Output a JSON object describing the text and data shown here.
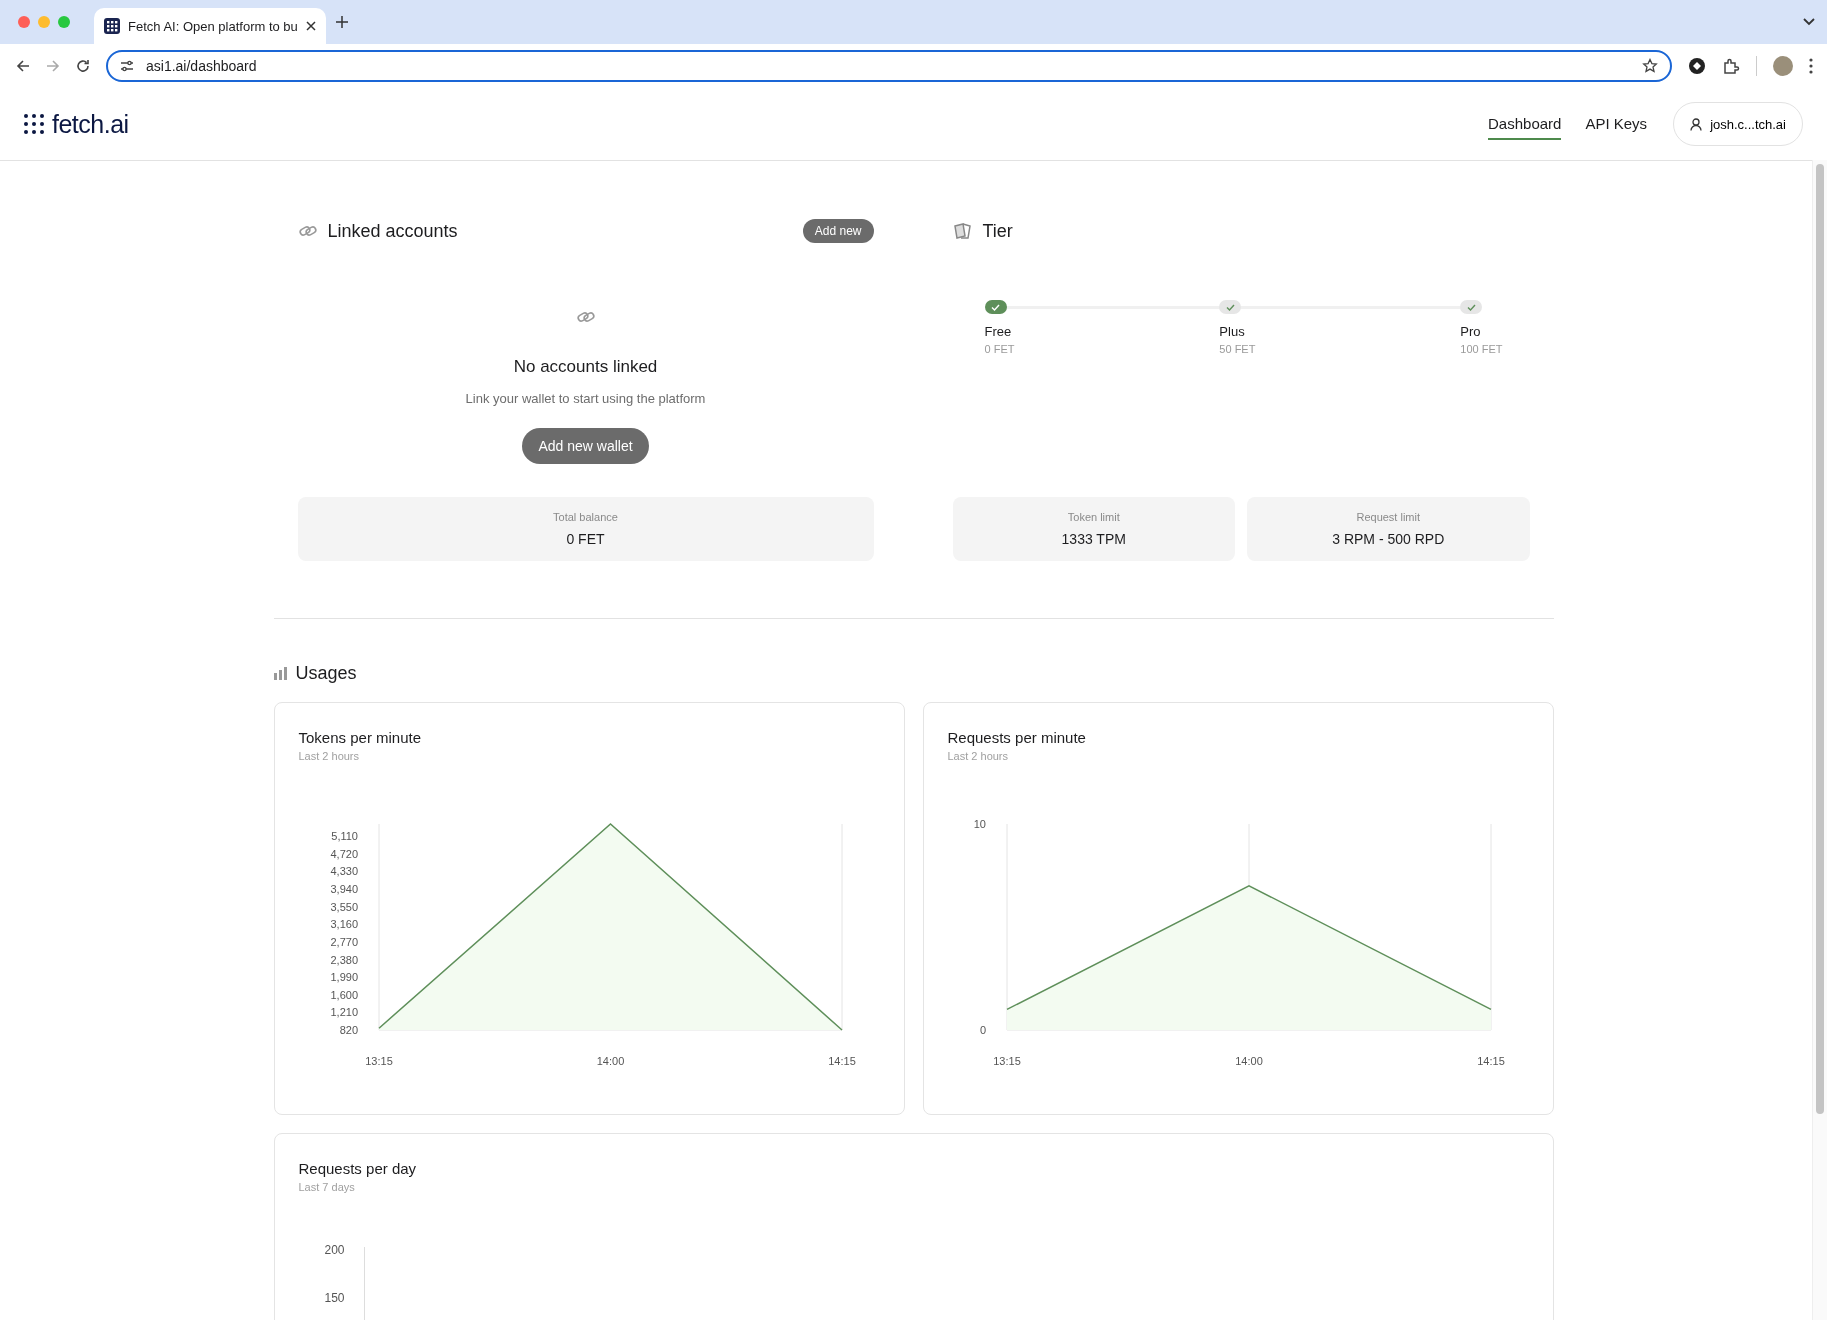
{
  "browser": {
    "tabs": [
      {
        "title": "Fetch AI: Open platform to bu",
        "selected": true
      }
    ],
    "url": "asi1.ai/dashboard"
  },
  "header": {
    "logo": "fetch.ai",
    "nav": [
      {
        "label": "Dashboard",
        "selected": true
      },
      {
        "label": "API Keys",
        "selected": false
      }
    ],
    "user": "josh.c...tch.ai"
  },
  "linked_accounts": {
    "title": "Linked accounts",
    "add_button": "Add new",
    "empty_title": "No accounts linked",
    "empty_text": "Link your wallet to start using the platform",
    "wallet_button": "Add new wallet",
    "stat": {
      "label": "Total balance",
      "value": "0 FET"
    }
  },
  "tier": {
    "title": "Tier",
    "levels": [
      {
        "name": "Free",
        "price": "0 FET",
        "selected": true
      },
      {
        "name": "Plus",
        "price": "50 FET",
        "selected": false
      },
      {
        "name": "Pro",
        "price": "100 FET",
        "selected": false
      }
    ],
    "stats": [
      {
        "label": "Token limit",
        "value": "1333 TPM"
      },
      {
        "label": "Request limit",
        "value": "3 RPM - 500 RPD"
      }
    ]
  },
  "usages": {
    "title": "Usages",
    "charts": [
      {
        "title": "Tokens per minute",
        "subtitle": "Last 2 hours",
        "chart_data": {
          "type": "area",
          "x": [
            "13:15",
            "14:00",
            "14:15"
          ],
          "series": [
            {
              "color": "#5e8f5a",
              "values": [
                860,
                5380,
                820
              ]
            }
          ],
          "ylim": [
            820,
            5380
          ],
          "yticks": [
            {
              "value": 820,
              "label": "820"
            },
            {
              "value": 1210,
              "label": "1,210"
            },
            {
              "value": 1600,
              "label": "1,600"
            },
            {
              "value": 1990,
              "label": "1,990"
            },
            {
              "value": 2380,
              "label": "2,380"
            },
            {
              "value": 2770,
              "label": "2,770"
            },
            {
              "value": 3160,
              "label": "3,160"
            },
            {
              "value": 3550,
              "label": "3,550"
            },
            {
              "value": 3940,
              "label": "3,940"
            },
            {
              "value": 4330,
              "label": "4,330"
            },
            {
              "value": 4720,
              "label": "4,720"
            },
            {
              "value": 5110,
              "label": "5,110"
            }
          ]
        }
      },
      {
        "title": "Requests per minute",
        "subtitle": "Last 2 hours",
        "chart_data": {
          "type": "area",
          "x": [
            "13:15",
            "14:00",
            "14:15"
          ],
          "series": [
            {
              "color": "#5e8f5a",
              "values": [
                1,
                7,
                1
              ]
            }
          ],
          "ylim": [
            0,
            10
          ],
          "yticks": [
            0,
            10
          ]
        }
      }
    ],
    "daily": {
      "title": "Requests per day",
      "subtitle": "Last 7 days",
      "y_labels": [
        "200",
        "150"
      ]
    }
  }
}
